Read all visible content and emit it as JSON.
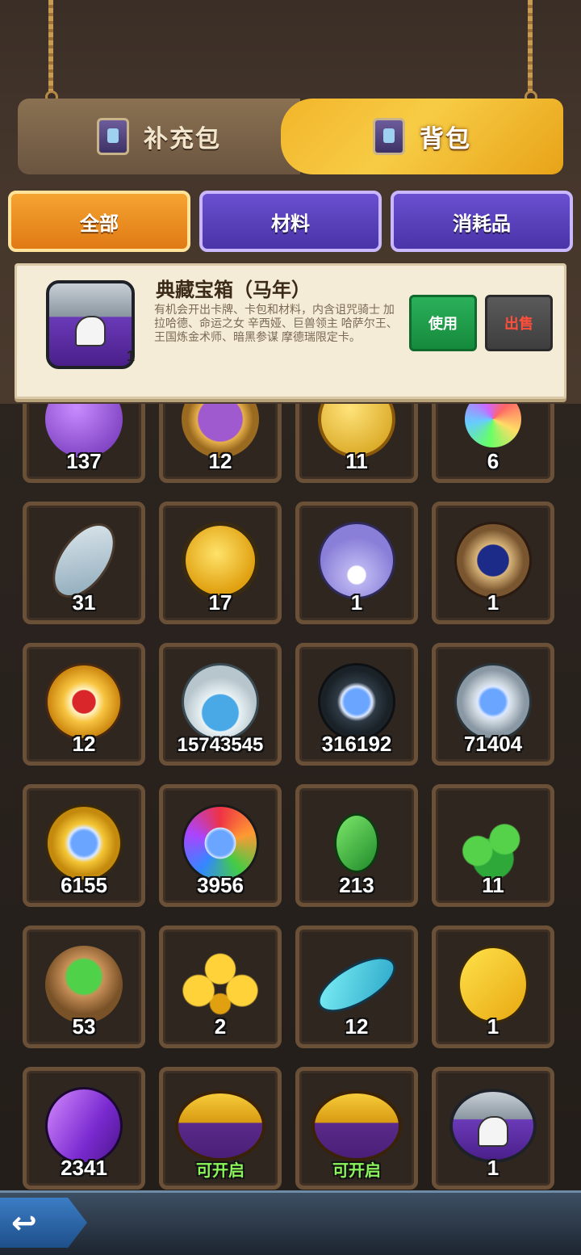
{
  "main_tabs": [
    {
      "label": "补充包",
      "icon": "card-pack-chest-icon",
      "active": false
    },
    {
      "label": "背包",
      "icon": "card-pack-chest-icon",
      "active": true
    }
  ],
  "sub_tabs": [
    {
      "label": "全部",
      "active": true
    },
    {
      "label": "材料",
      "active": false
    },
    {
      "label": "消耗品",
      "active": false
    }
  ],
  "selected_item": {
    "title": "典藏宝箱（马年）",
    "description": "有机会开出卡牌、卡包和材料，内含诅咒骑士 加拉哈德、命运之女 辛西娅、巨兽领主 哈萨尔王、王国炼金术师、暗黑参谋 摩德瑞限定卡。",
    "count": "1",
    "icon": "horse-chest-icon",
    "use_label": "使用",
    "sell_label": "出售"
  },
  "items": [
    {
      "icon": "purple-gem-icon",
      "qty": "137"
    },
    {
      "icon": "magic-mirror-icon",
      "qty": "12"
    },
    {
      "icon": "gold-medal-icon",
      "qty": "11"
    },
    {
      "icon": "rainbow-crystal-icon",
      "qty": "6"
    },
    {
      "icon": "scroll-tag-icon",
      "qty": "31"
    },
    {
      "icon": "crown-coin-icon",
      "qty": "17"
    },
    {
      "icon": "pearl-shell-icon",
      "qty": "1"
    },
    {
      "icon": "hourglass-clock-icon",
      "qty": "1"
    },
    {
      "icon": "paw-coin-icon",
      "qty": "12"
    },
    {
      "icon": "sand-flask-icon",
      "qty": "15743545"
    },
    {
      "icon": "dark-gem-coin-icon",
      "qty": "316192"
    },
    {
      "icon": "silver-gem-coin-icon",
      "qty": "71404"
    },
    {
      "icon": "gold-gem-coin-icon",
      "qty": "6155"
    },
    {
      "icon": "rainbow-gem-coin-icon",
      "qty": "3956"
    },
    {
      "icon": "green-leaf-icon",
      "qty": "213"
    },
    {
      "icon": "green-leaves-pile-icon",
      "qty": "11"
    },
    {
      "icon": "leaf-sack-icon",
      "qty": "53"
    },
    {
      "icon": "fleur-de-lis-icon",
      "qty": "2"
    },
    {
      "icon": "blue-ticket-icon",
      "qty": "12"
    },
    {
      "icon": "gold-horse-icon",
      "qty": "1"
    },
    {
      "icon": "purple-crystal-icon",
      "qty": "2341"
    },
    {
      "icon": "gold-chest-icon",
      "qty": "可开启"
    },
    {
      "icon": "gold-chest-icon",
      "qty": "可开启"
    },
    {
      "icon": "horse-chest-icon",
      "qty": "1"
    }
  ],
  "colors": {
    "accent_orange": "#e8891c",
    "accent_purple": "#5a3fbf",
    "use_green": "#1e9a48",
    "sell_red": "#ff4f3a",
    "openable_green": "#8cf55a"
  }
}
